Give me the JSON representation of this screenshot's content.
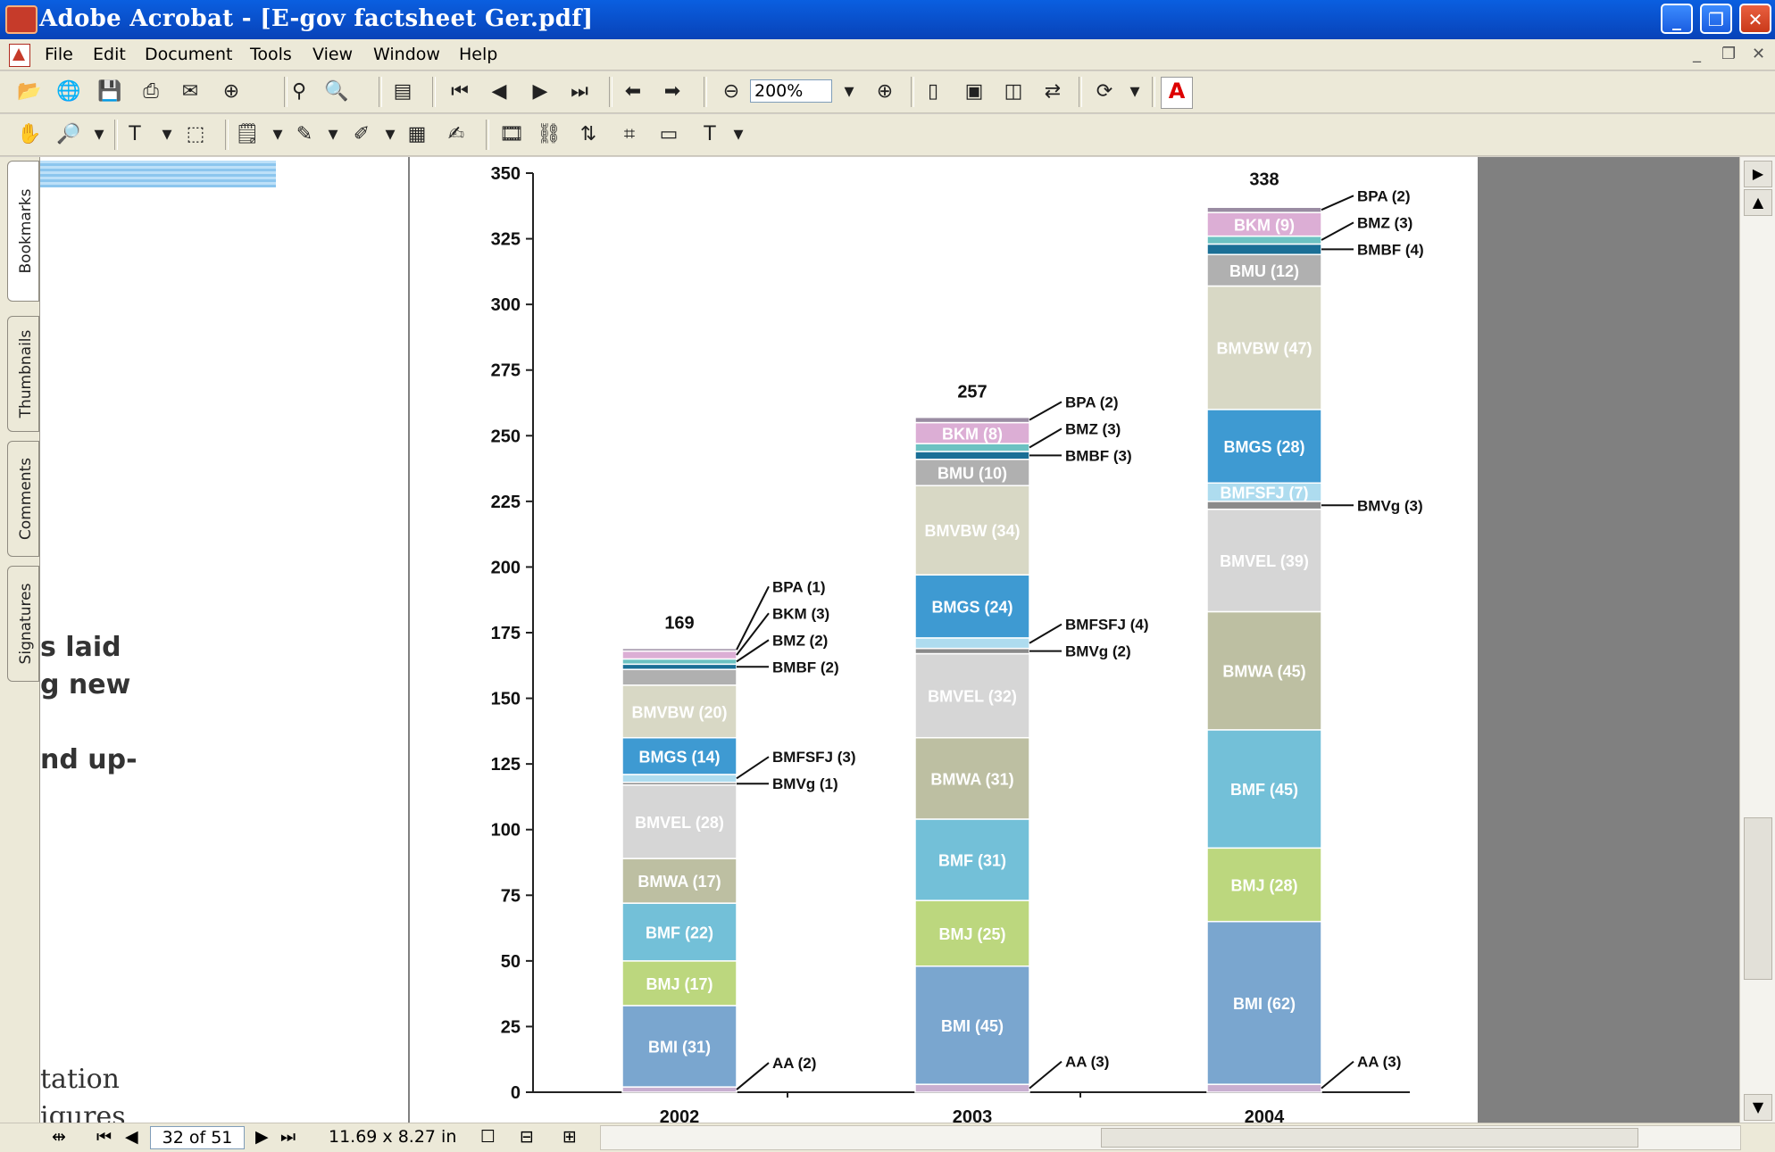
{
  "window": {
    "title": "Adobe Acrobat - [E-gov factsheet  Ger.pdf]",
    "buttons": {
      "minimize": "_",
      "restore": "❐",
      "close": "✕"
    }
  },
  "menu": [
    "File",
    "Edit",
    "Document",
    "Tools",
    "View",
    "Window",
    "Help"
  ],
  "toolbar": {
    "zoom_value": "200%",
    "adobe_label": "A"
  },
  "nav_tabs": [
    "Bookmarks",
    "Thumbnails",
    "Comments",
    "Signatures"
  ],
  "left_page_text": [
    "s laid",
    "g new",
    "nd up-",
    "tation",
    "igures"
  ],
  "status": {
    "page": "32 of 51",
    "size": "11.69 x 8.27 in"
  },
  "chart_data": {
    "type": "bar",
    "stacked": true,
    "categories": [
      "2002",
      "2003",
      "2004"
    ],
    "totals": [
      169,
      257,
      338
    ],
    "ylim": [
      0,
      350
    ],
    "yticks": [
      0,
      25,
      50,
      75,
      100,
      125,
      150,
      175,
      200,
      225,
      250,
      275,
      300,
      325,
      350
    ],
    "series": [
      {
        "name": "AA",
        "values": [
          2,
          3,
          3
        ],
        "color": "#c8aed0"
      },
      {
        "name": "BMI",
        "values": [
          31,
          45,
          62
        ],
        "color": "#7aa6cf"
      },
      {
        "name": "BMJ",
        "values": [
          17,
          25,
          28
        ],
        "color": "#bcd77e"
      },
      {
        "name": "BMF",
        "values": [
          22,
          31,
          45
        ],
        "color": "#73c0d8"
      },
      {
        "name": "BMWA",
        "values": [
          17,
          31,
          45
        ],
        "color": "#bdbfa2"
      },
      {
        "name": "BMVEL",
        "values": [
          28,
          32,
          39
        ],
        "color": "#d6d6d6"
      },
      {
        "name": "BMVg",
        "values": [
          1,
          2,
          3
        ],
        "color": "#8a8a8a"
      },
      {
        "name": "BMFSFJ",
        "values": [
          3,
          4,
          7
        ],
        "color": "#aedcef"
      },
      {
        "name": "BMGS",
        "values": [
          14,
          24,
          28
        ],
        "color": "#3e9ad2"
      },
      {
        "name": "BMVBW",
        "values": [
          20,
          34,
          47
        ],
        "color": "#d8d8c5"
      },
      {
        "name": "BMU",
        "values": [
          6,
          10,
          12
        ],
        "color": "#b0b0b0"
      },
      {
        "name": "BMBF",
        "values": [
          2,
          3,
          4
        ],
        "color": "#1a6f96"
      },
      {
        "name": "BMZ",
        "values": [
          2,
          3,
          3
        ],
        "color": "#6cc2c2"
      },
      {
        "name": "BKM",
        "values": [
          3,
          8,
          9
        ],
        "color": "#dcaed5"
      },
      {
        "name": "BPA",
        "values": [
          1,
          2,
          2
        ],
        "color": "#9a8ca2"
      }
    ]
  }
}
